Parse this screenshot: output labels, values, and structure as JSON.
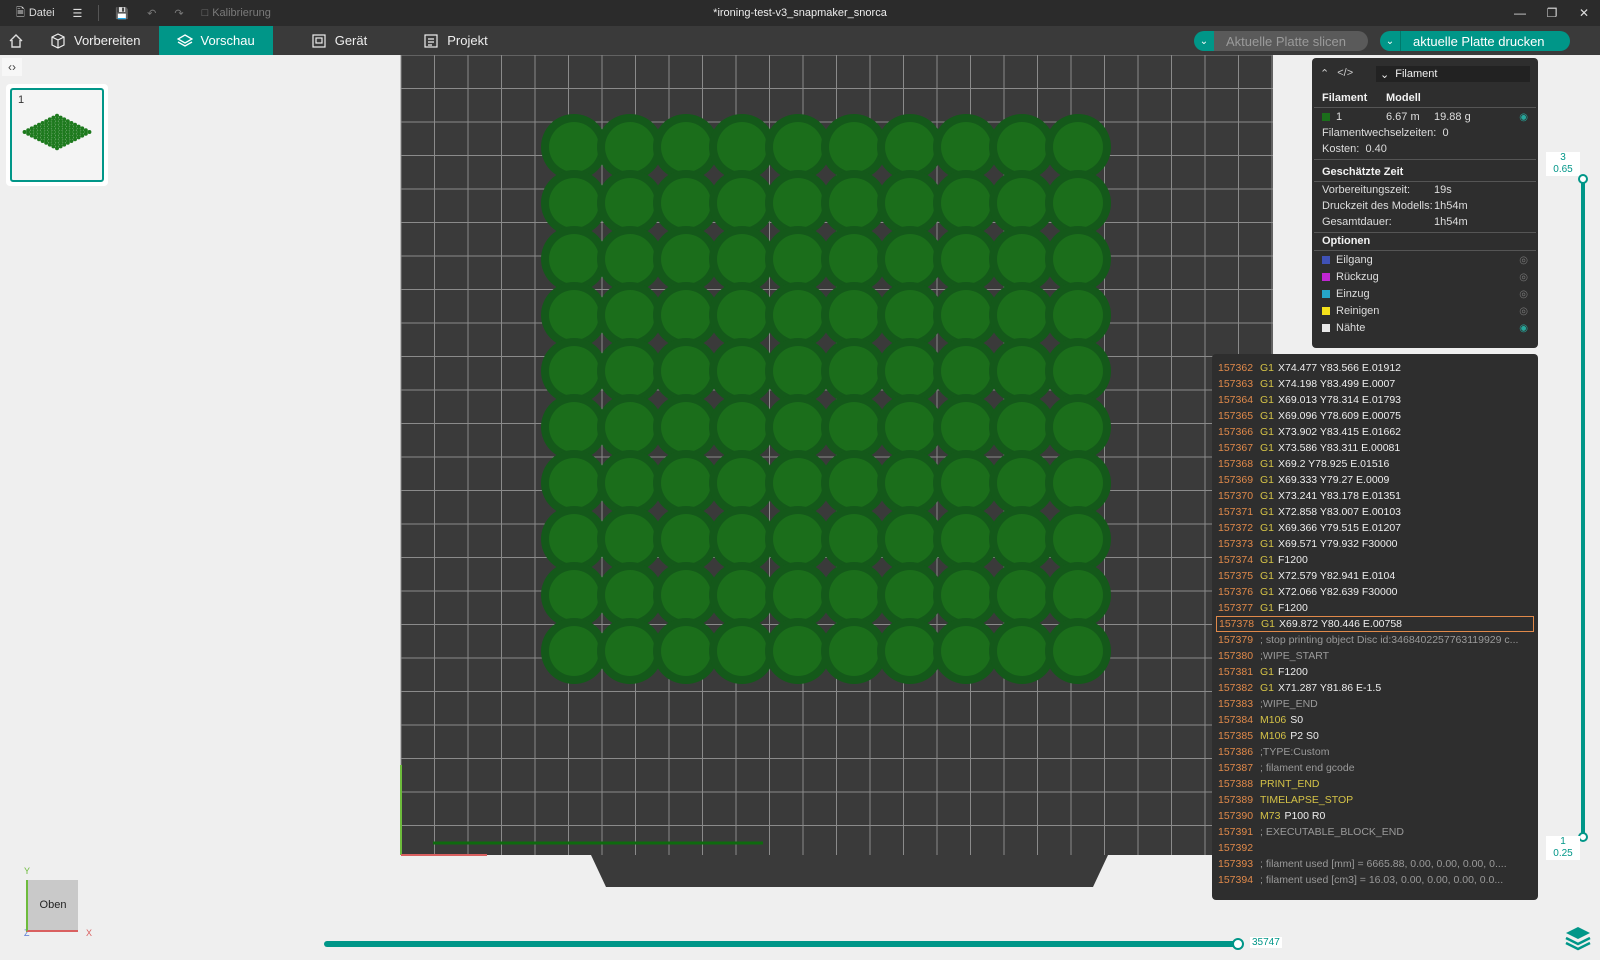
{
  "titlebar": {
    "file_label": "Datei",
    "calibration_label": "Kalibrierung",
    "window_title": "*ironing-test-v3_snapmaker_snorca"
  },
  "nav": {
    "tabs": [
      {
        "label": "Vorbereiten"
      },
      {
        "label": "Vorschau"
      },
      {
        "label": "Gerät"
      },
      {
        "label": "Projekt"
      }
    ],
    "slice_label": "Aktuelle Platte slicen",
    "print_label": "aktuelle Platte drucken"
  },
  "plates": [
    {
      "number": "1"
    }
  ],
  "orientation": {
    "cube_label": "Oben",
    "axis_y": "Y",
    "axis_x": "X",
    "axis_z": "Z"
  },
  "panel": {
    "view_select": "Filament",
    "col_filament": "Filament",
    "col_model": "Modell",
    "filament": {
      "id": "1",
      "length": "6.67 m",
      "weight": "19.88 g",
      "color": "#1b6e1b"
    },
    "changes_label": "Filamentwechselzeiten:",
    "changes_value": "0",
    "cost_label": "Kosten:",
    "cost_value": "0.40",
    "time_header": "Geschätzte Zeit",
    "prep_label": "Vorbereitungszeit:",
    "prep_value": "19s",
    "model_time_label": "Druckzeit des Modells:",
    "model_time_value": "1h54m",
    "total_label": "Gesamtdauer:",
    "total_value": "1h54m",
    "options_header": "Optionen",
    "options": [
      {
        "label": "Eilgang",
        "color": "#3f51b5",
        "visible": false
      },
      {
        "label": "Rückzug",
        "color": "#c026d3",
        "visible": false
      },
      {
        "label": "Einzug",
        "color": "#26a6c9",
        "visible": false
      },
      {
        "label": "Reinigen",
        "color": "#f5e11b",
        "visible": false
      },
      {
        "label": "Nähte",
        "color": "#e8e8e8",
        "visible": true
      }
    ]
  },
  "gcode": [
    {
      "ln": "157362",
      "cmd": "G1",
      "args": "X74.477 Y83.566 E.01912"
    },
    {
      "ln": "157363",
      "cmd": "G1",
      "args": "X74.198 Y83.499 E.0007"
    },
    {
      "ln": "157364",
      "cmd": "G1",
      "args": "X69.013 Y78.314 E.01793"
    },
    {
      "ln": "157365",
      "cmd": "G1",
      "args": "X69.096 Y78.609 E.00075"
    },
    {
      "ln": "157366",
      "cmd": "G1",
      "args": "X73.902 Y83.415 E.01662"
    },
    {
      "ln": "157367",
      "cmd": "G1",
      "args": "X73.586 Y83.311 E.00081"
    },
    {
      "ln": "157368",
      "cmd": "G1",
      "args": "X69.2 Y78.925 E.01516"
    },
    {
      "ln": "157369",
      "cmd": "G1",
      "args": "X69.333 Y79.27 E.0009"
    },
    {
      "ln": "157370",
      "cmd": "G1",
      "args": "X73.241 Y83.178 E.01351"
    },
    {
      "ln": "157371",
      "cmd": "G1",
      "args": "X72.858 Y83.007 E.00103"
    },
    {
      "ln": "157372",
      "cmd": "G1",
      "args": "X69.366 Y79.515 E.01207"
    },
    {
      "ln": "157373",
      "cmd": "G1",
      "args": "X69.571 Y79.932 F30000"
    },
    {
      "ln": "157374",
      "cmd": "G1",
      "args": "F1200"
    },
    {
      "ln": "157375",
      "cmd": "G1",
      "args": "X72.579 Y82.941 E.0104"
    },
    {
      "ln": "157376",
      "cmd": "G1",
      "args": "X72.066 Y82.639 F30000"
    },
    {
      "ln": "157377",
      "cmd": "G1",
      "args": "F1200"
    },
    {
      "ln": "157378",
      "cmd": "G1",
      "args": "X69.872 Y80.446 E.00758",
      "selected": true
    },
    {
      "ln": "157379",
      "cmd": "",
      "args": "; stop printing object Disc id:3468402257763119929 c...",
      "comment": true
    },
    {
      "ln": "157380",
      "cmd": "",
      "args": ";WIPE_START",
      "comment": true
    },
    {
      "ln": "157381",
      "cmd": "G1",
      "args": "F1200"
    },
    {
      "ln": "157382",
      "cmd": "G1",
      "args": "X71.287 Y81.86 E-1.5"
    },
    {
      "ln": "157383",
      "cmd": "",
      "args": ";WIPE_END",
      "comment": true
    },
    {
      "ln": "157384",
      "cmd": "M106",
      "args": "S0"
    },
    {
      "ln": "157385",
      "cmd": "M106",
      "args": "P2 S0"
    },
    {
      "ln": "157386",
      "cmd": "",
      "args": ";TYPE:Custom",
      "comment": true
    },
    {
      "ln": "157387",
      "cmd": "",
      "args": "; filament end gcode",
      "comment": true
    },
    {
      "ln": "157388",
      "cmd": "PRINT_END",
      "args": ""
    },
    {
      "ln": "157389",
      "cmd": "TIMELAPSE_STOP",
      "args": ""
    },
    {
      "ln": "157390",
      "cmd": "M73",
      "args": "P100 R0"
    },
    {
      "ln": "157391",
      "cmd": "",
      "args": "; EXECUTABLE_BLOCK_END",
      "comment": true
    },
    {
      "ln": "157392",
      "cmd": "",
      "args": ""
    },
    {
      "ln": "157393",
      "cmd": "",
      "args": "; filament used [mm] = 6665.88, 0.00, 0.00, 0.00, 0....",
      "comment": true
    },
    {
      "ln": "157394",
      "cmd": "",
      "args": "; filament used [cm3] = 16.03, 0.00, 0.00, 0.00, 0.0...",
      "comment": true
    }
  ],
  "layer_slider": {
    "top_layer": "3",
    "top_height": "0.65",
    "bottom_layer": "1",
    "bottom_height": "0.25"
  },
  "move_slider": {
    "value": "35747",
    "progress": 1.0
  },
  "model": {
    "grid_rows": 10,
    "grid_cols": 10,
    "color": "#1b6e1b"
  }
}
